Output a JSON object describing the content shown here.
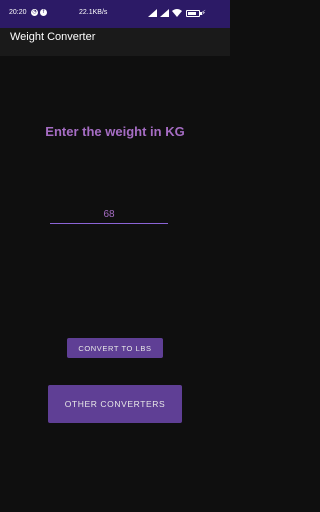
{
  "status_bar": {
    "time": "20:20",
    "network_speed": "22.1KB/s",
    "battery_level": 0.8,
    "icons": [
      "notification-icon",
      "notification-icon",
      "signal-icon",
      "signal-icon",
      "wifi-icon",
      "battery-icon",
      "charging-bolt-icon"
    ]
  },
  "app_bar": {
    "title": "Weight Converter"
  },
  "main": {
    "prompt": "Enter the weight in KG",
    "weight_input": {
      "value": "68",
      "placeholder": ""
    },
    "convert_button_label": "CONVERT TO LBS",
    "other_converters_label": "OTHER CONVERTERS"
  },
  "colors": {
    "status_bar_bg": "#2c1a66",
    "background": "#0f0f0f",
    "accent_text": "#a66dc4",
    "button_bg": "#5f3f95",
    "input_underline": "#8b64d6"
  }
}
